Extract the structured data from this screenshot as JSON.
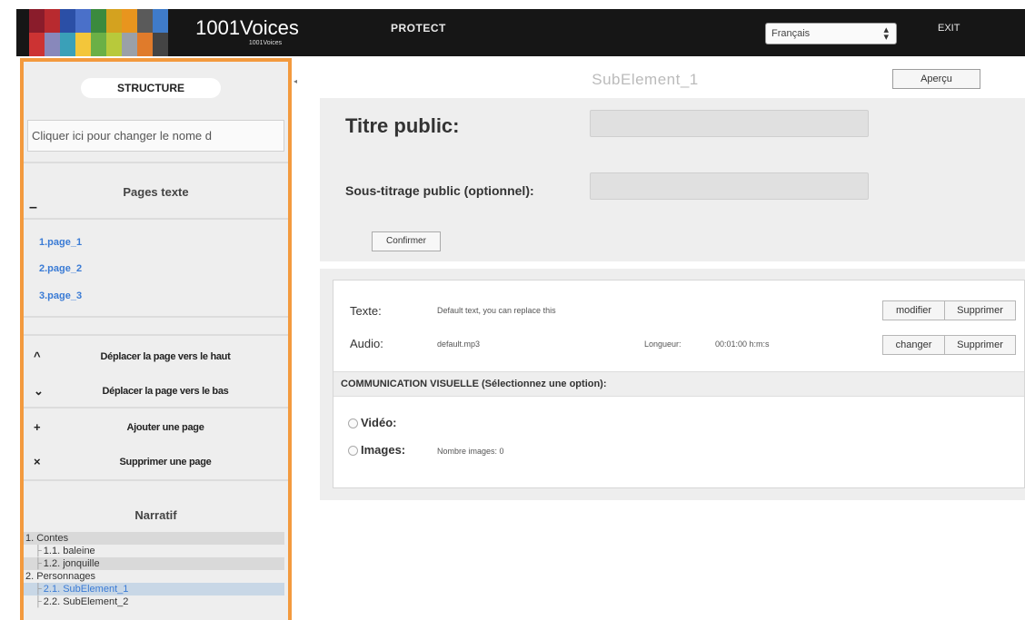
{
  "header": {
    "brand": "1001Voices",
    "brand_sub": "1001Voices",
    "logo_colors": [
      "#8a1c2b",
      "#b82a2f",
      "#2b4fa6",
      "#4a70c9",
      "#3b8a3e",
      "#d4a21f",
      "#e8951e",
      "#5a5a5a",
      "#3f7bc9",
      "#c33",
      "#88b",
      "#3aa0b8",
      "#f3c63a",
      "#6bb046",
      "#b8c93b",
      "#9aa0a8",
      "#e07b2b",
      "#444"
    ],
    "nav_protect": "PROTECT",
    "language": "Français",
    "exit": "EXIT"
  },
  "sidebar": {
    "heading": "STRUCTURE",
    "rename_placeholder": "Cliquer ici pour changer le nome d",
    "pages_title": "Pages texte",
    "collapse": "–",
    "pages": [
      "1.page_1",
      "2.page_2",
      "3.page_3"
    ],
    "actions": [
      {
        "icon": "^",
        "label": "Déplacer la page vers le haut"
      },
      {
        "icon": "⌄",
        "label": "Déplacer la page vers le bas"
      },
      {
        "icon": "+",
        "label": "Ajouter une page"
      },
      {
        "icon": "×",
        "label": "Supprimer une page"
      }
    ],
    "narratif_title": "Narratif",
    "tree": [
      "1. Contes",
      "1.1. baleine",
      "1.2. jonquille",
      "2. Personnages",
      "2.1. SubElement_1",
      "2.2. SubElement_2"
    ]
  },
  "main": {
    "title": "SubElement_1",
    "apercu": "Aperçu",
    "titre_public_label": "Titre public:",
    "sous_titrage_label": "Sous-titrage public (optionnel):",
    "confirmer": "Confirmer",
    "texte_label": "Texte:",
    "texte_value": "Default text, you can replace this",
    "modifier": "modifier",
    "supprimer": "Supprimer",
    "audio_label": "Audio:",
    "audio_value": "default.mp3",
    "longueur_label": "Longueur:",
    "longueur_value": "00:01:00 h:m:s",
    "changer": "changer",
    "visual_heading": "COMMUNICATION VISUELLE (Sélectionnez une option):",
    "video_label": "Vidéo:",
    "images_label": "Images:",
    "nombre_images": "Nombre images: 0"
  }
}
